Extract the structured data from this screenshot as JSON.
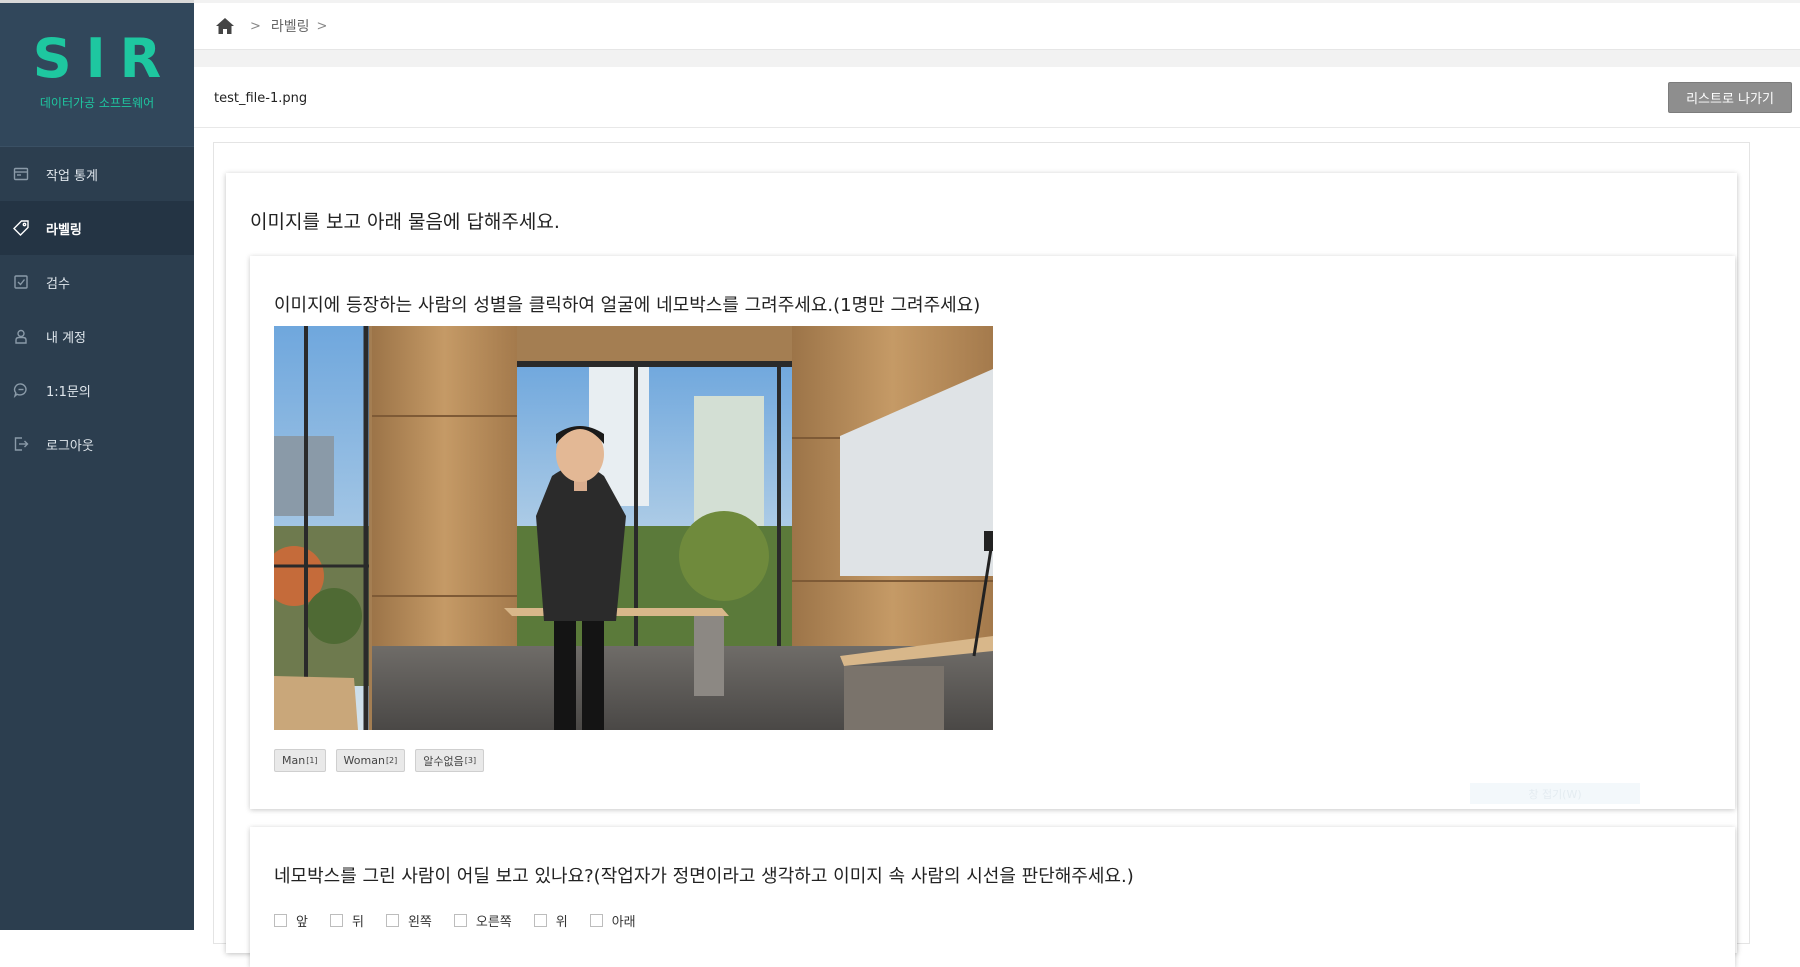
{
  "brand": {
    "logo": "SIR",
    "subtitle": "데이터가공 소프트웨어",
    "color": "#1ec7a0"
  },
  "sidebar": {
    "items": [
      {
        "label": "작업 통계",
        "icon": "chart-icon",
        "active": false
      },
      {
        "label": "라벨링",
        "icon": "tag-icon",
        "active": true
      },
      {
        "label": "검수",
        "icon": "checkbox-icon",
        "active": false
      },
      {
        "label": "내 계정",
        "icon": "user-icon",
        "active": false
      },
      {
        "label": "1:1문의",
        "icon": "chat-icon",
        "active": false
      },
      {
        "label": "로그아웃",
        "icon": "logout-icon",
        "active": false
      }
    ]
  },
  "breadcrumb": {
    "icon": "home-icon",
    "sep1": ">",
    "item": "라벨링",
    "sep2": ">"
  },
  "file": {
    "name": "test_file-1.png",
    "back_button": "리스트로 나가기"
  },
  "task": {
    "title": "이미지를 보고 아래 물음에 답해주세요.",
    "question1": {
      "title": "이미지에 등장하는 사람의 성별을 클릭하여 얼굴에 네모박스를 그려주세요.(1명만 그려주세요)",
      "answers": [
        {
          "label": "Man",
          "key": "[1]"
        },
        {
          "label": "Woman",
          "key": "[2]"
        },
        {
          "label": "알수없음",
          "key": "[3]"
        }
      ],
      "save_label": "창 접기(W)"
    },
    "question2": {
      "title": "네모박스를 그린 사람이 어딜 보고 있나요?(작업자가 정면이라고 생각하고 이미지 속 사람의 시선을 판단해주세요.)",
      "options": [
        "앞",
        "뒤",
        "왼쪽",
        "오른쪽",
        "위",
        "아래"
      ]
    }
  }
}
